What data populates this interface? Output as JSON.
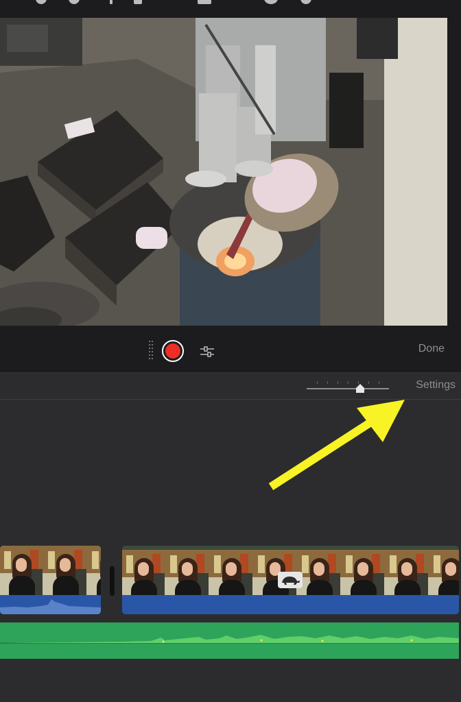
{
  "preview": {
    "description_icon": "video-preview"
  },
  "controls": {
    "record_color": "#ee2e24",
    "done_label": "Done"
  },
  "timeline": {
    "settings_label": "Settings",
    "annotation_arrow_color": "#f8f324",
    "video_track_color": "#2a56a8",
    "music_track_color": "#2ea35a"
  }
}
